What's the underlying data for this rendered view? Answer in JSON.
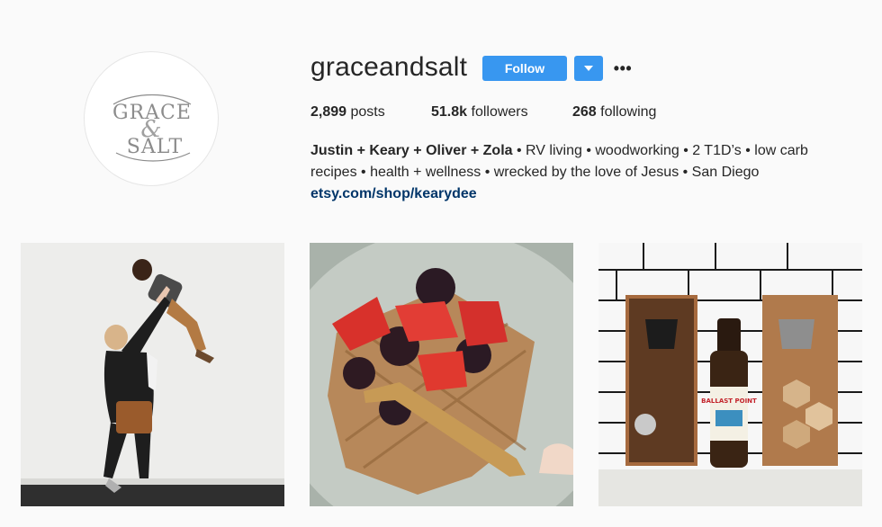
{
  "profile": {
    "username": "graceandsalt",
    "logo_text": [
      "GRACE",
      "&",
      "SALT"
    ],
    "follow_label": "Follow",
    "more_label": "•••"
  },
  "stats": {
    "posts_count": "2,899",
    "posts_label": "posts",
    "followers_count": "51.8k",
    "followers_label": "followers",
    "following_count": "268",
    "following_label": "following"
  },
  "bio": {
    "name": "Justin + Keary + Oliver + Zola",
    "line1_rest": " • RV living • woodworking • 2 T1D’s • low carb",
    "line2": "recipes • health + wellness • wrecked by the love of Jesus • San Diego",
    "link": "etsy.com/shop/kearydee"
  },
  "posts": [
    {
      "label": "",
      "icon": "photo-mother-lifting-child"
    },
    {
      "label": "",
      "icon": "photo-waffle-with-berries"
    },
    {
      "label": "BALLAST POINT",
      "icon": "photo-bottle-openers-and-beer"
    }
  ],
  "colors": {
    "accent": "#3897f0",
    "link": "#003569",
    "text": "#262626",
    "background": "#fafafa"
  }
}
